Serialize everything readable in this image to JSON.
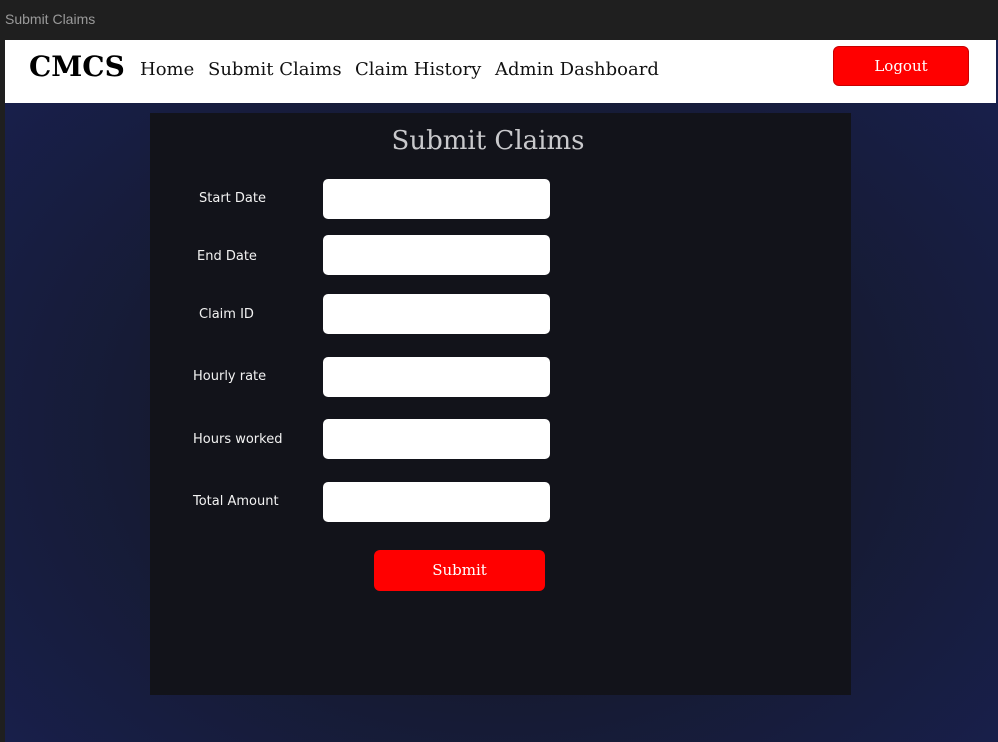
{
  "window": {
    "title": "Submit Claims"
  },
  "navbar": {
    "brand": "CMCS",
    "links": [
      {
        "label": "Home"
      },
      {
        "label": "Submit Claims"
      },
      {
        "label": "Claim History"
      },
      {
        "label": "Admin Dashboard"
      }
    ],
    "logout_label": "Logout"
  },
  "form": {
    "title": "Submit Claims",
    "fields": [
      {
        "label": "Start Date",
        "value": ""
      },
      {
        "label": "End Date",
        "value": ""
      },
      {
        "label": "Claim ID",
        "value": ""
      },
      {
        "label": "Hourly rate",
        "value": ""
      },
      {
        "label": "Hours worked",
        "value": ""
      },
      {
        "label": "Total Amount",
        "value": ""
      }
    ],
    "submit_label": "Submit"
  },
  "colors": {
    "accent": "#ff0000",
    "background": "#18204f",
    "panel": "#12131a",
    "navbar": "#ffffff"
  }
}
